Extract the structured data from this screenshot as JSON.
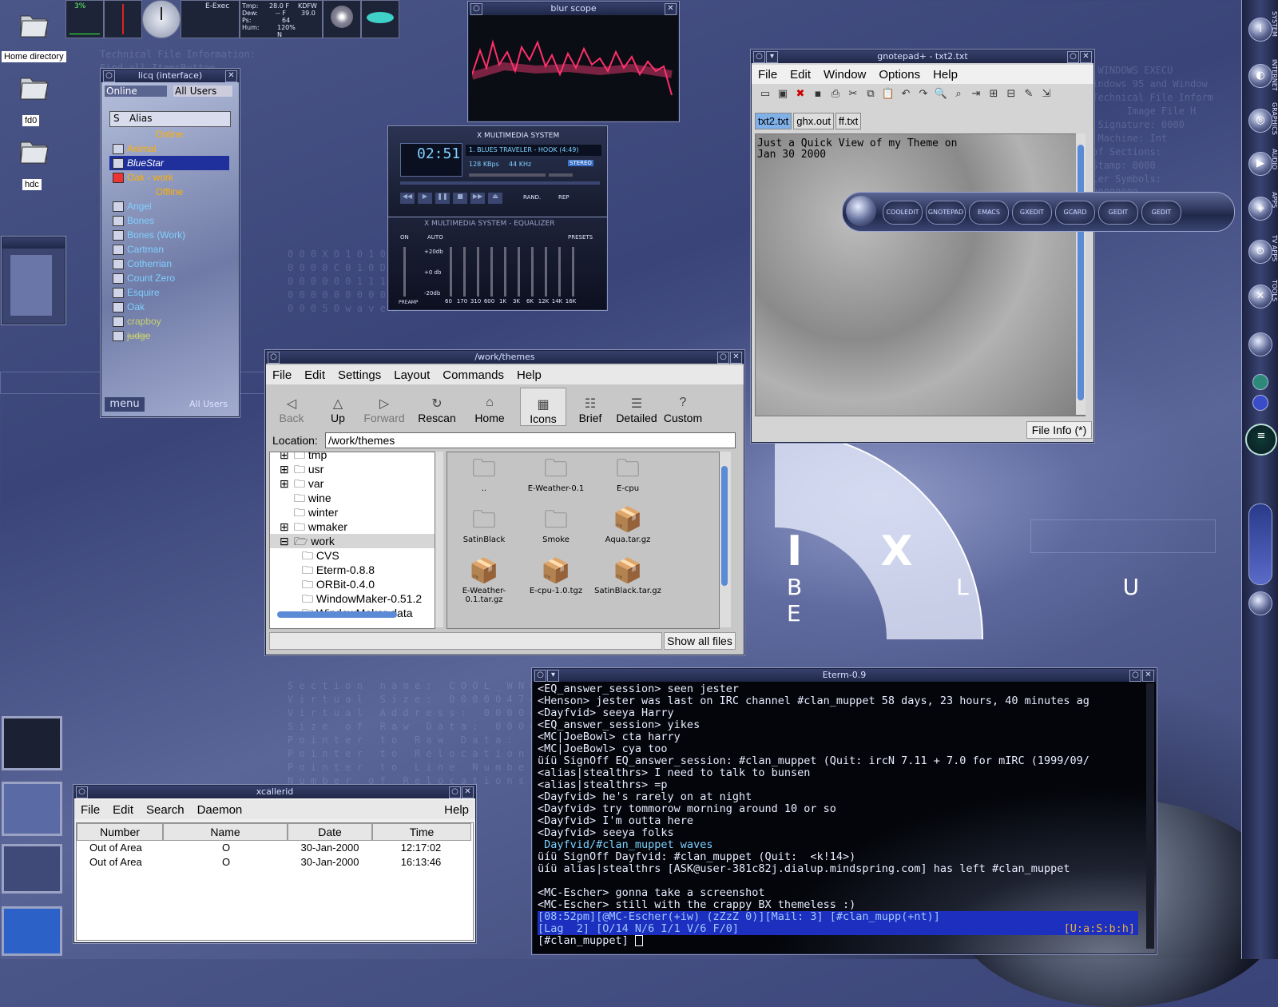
{
  "desktop": {
    "icons": [
      {
        "label": "Home directory"
      },
      {
        "label": "fd0"
      },
      {
        "label": "hdc"
      }
    ],
    "splash": {
      "line1": "I X",
      "line2": "B L U E"
    }
  },
  "dockapps": {
    "cpu_percent": "3%",
    "eexec_label": "E-Exec",
    "weather": {
      "tmp_label": "Tmp:",
      "tmp_value": "28.0 F",
      "dew_label": "Dew:",
      "dew_value": "-- F",
      "p_label": "Ps:",
      "p_value": "64",
      "hum_label": "Hum:",
      "hum_value": "120%",
      "station": "KDFW",
      "pressure": "39.0",
      "wind": "N"
    }
  },
  "blurscope": {
    "title": "blur scope"
  },
  "xmms": {
    "title": "X MULTIMEDIA SYSTEM",
    "time": "02:51",
    "track": "1. BLUES TRAVELER - HOOK (4:49)",
    "kbps": "128 KBps",
    "khz": "44 KHz",
    "stereo": "STEREO",
    "eq_title": "X MULTIMEDIA SYSTEM - EQUALIZER",
    "eq_on": "ON",
    "eq_auto": "AUTO",
    "eq_presets": "PRESETS",
    "eq_db": [
      "+20db",
      "+0 db",
      "-20db"
    ],
    "eq_preamp": "PREAMP",
    "eq_bands": [
      "60",
      "170",
      "310",
      "600",
      "1K",
      "3K",
      "6K",
      "12K",
      "14K",
      "16K"
    ],
    "buttons": {
      "rand": "RAND.",
      "rep": "REP"
    }
  },
  "licq": {
    "title": "licq (interface)",
    "status": "Online",
    "group": "All Users",
    "col_s": "S",
    "col_alias": "Alias",
    "online_header": "Online",
    "offline_header": "Offline",
    "online": [
      "Animal",
      "BlueStar",
      "Oak - work"
    ],
    "offline": [
      "Angel",
      "Bones",
      "Bones (Work)",
      "Cartman",
      "Cotherrian",
      "Count Zero",
      "Esquire",
      "Oak",
      "crapboy",
      "judge"
    ],
    "menu_btn": "menu",
    "bottom_group": "All Users"
  },
  "filemanager": {
    "title": "/work/themes",
    "menu": [
      "File",
      "Edit",
      "Settings",
      "Layout",
      "Commands",
      "Help"
    ],
    "toolbar": [
      {
        "label": "Back",
        "icon": "back-icon",
        "glyph": "◁"
      },
      {
        "label": "Up",
        "icon": "up-icon",
        "glyph": "△"
      },
      {
        "label": "Forward",
        "icon": "forward-icon",
        "glyph": "▷"
      },
      {
        "label": "Rescan",
        "icon": "rescan-icon",
        "glyph": "↻"
      },
      {
        "label": "Home",
        "icon": "home-icon",
        "glyph": "⌂"
      },
      {
        "label": "Icons",
        "icon": "icons-view-icon",
        "glyph": "▦"
      },
      {
        "label": "Brief",
        "icon": "brief-view-icon",
        "glyph": "☷"
      },
      {
        "label": "Detailed",
        "icon": "detailed-view-icon",
        "glyph": "☰"
      },
      {
        "label": "Custom",
        "icon": "custom-view-icon",
        "glyph": "?"
      }
    ],
    "location_label": "Location:",
    "location_value": "/work/themes",
    "tree": [
      "tmp",
      "usr",
      "var",
      "wine",
      "winter",
      "wmaker",
      "work",
      "CVS",
      "Eterm-0.8.8",
      "ORBit-0.4.0",
      "WindowMaker-0.51.2",
      "WindowMaker-data"
    ],
    "files": [
      "..",
      "E-Weather-0.1",
      "E-cpu",
      "SatinBlack",
      "Smoke",
      "Aqua.tar.gz",
      "E-Weather-0.1.tar.gz",
      "E-cpu-1.0.tgz",
      "SatinBlack.tar.gz"
    ],
    "show_all": "Show all files"
  },
  "gnotepad": {
    "title": "gnotepad+ - txt2.txt",
    "menu": [
      "File",
      "Edit",
      "Window",
      "Options",
      "Help"
    ],
    "tabs": [
      "txt2.txt",
      "ghx.out",
      "ff.txt"
    ],
    "text_line1": "Just a Quick View of my Theme on",
    "text_line2": "Jan 30 2000",
    "file_info": "File Info  (*)"
  },
  "launcher": {
    "buttons": [
      "COOLEDIT",
      "GNOTEPAD",
      "EMACS",
      "GXEDIT",
      "GCARD",
      "GEDIT",
      "GEDIT"
    ]
  },
  "xcallerid": {
    "title": "xcallerid",
    "menu": [
      "File",
      "Edit",
      "Search",
      "Daemon"
    ],
    "help": "Help",
    "columns": [
      "Number",
      "Name",
      "Date",
      "Time"
    ],
    "rows": [
      [
        "Out of Area",
        "O",
        "30-Jan-2000",
        "12:17:02"
      ],
      [
        "Out of Area",
        "O",
        "30-Jan-2000",
        "16:13:46"
      ]
    ]
  },
  "eterm": {
    "title": "Eterm-0.9",
    "lines": [
      "<EQ_answer_session> seen jester",
      "<Henson> jester was last on IRC channel #clan_muppet 58 days, 23 hours, 40 minutes ag",
      "<Dayfvid> seeya Harry",
      "<EQ_answer_session> yikes",
      "<MC|JoeBowl> cta harry",
      "<MC|JoeBowl> cya too",
      "üíü SignOff EQ_answer_session: #clan_muppet (Quit: ircN 7.11 + 7.0 for mIRC (1999/09/",
      "<alias|stealthrs> I need to talk to bunsen",
      "<alias|stealthrs> =p",
      "<Dayfvid> he's rarely on at night",
      "<Dayfvid> try tommorow morning around 10 or so",
      "<Dayfvid> I'm outta here",
      "<Dayfvid> seeya folks",
      " Dayfvid/#clan_muppet waves",
      "üíü SignOff Dayfvid: #clan_muppet (Quit:  <k!14>)",
      "üíü alias|stealthrs [ASK@user-381c82j.dialup.mindspring.com] has left #clan_muppet",
      "",
      "<MC-Escher> gonna take a screenshot",
      "<MC-Escher> still with the crappy BX themeless :)"
    ],
    "status1": "[08:52pm][@MC-Escher(+iw) (zZzZ 0)][Mail: 3] [#clan_mupp(+nt)]",
    "status2": "[Lag  2] [O/14 N/6 I/1 V/6 F/0]",
    "status2_right": "[U:a:S:b:h]",
    "prompt": "[#clan_muppet] "
  },
  "right_dock": {
    "labels": [
      "SYSTEM",
      "INTERNET",
      "GRAPHICS",
      "AUDIO",
      "APPS",
      "TV APPS",
      "TOOLS"
    ]
  },
  "colors": {
    "accent": "#1f2f9c",
    "licq_online": "#ffb000",
    "licq_offline": "#7fd0ff",
    "eterm_status": "#1d2fbf"
  }
}
